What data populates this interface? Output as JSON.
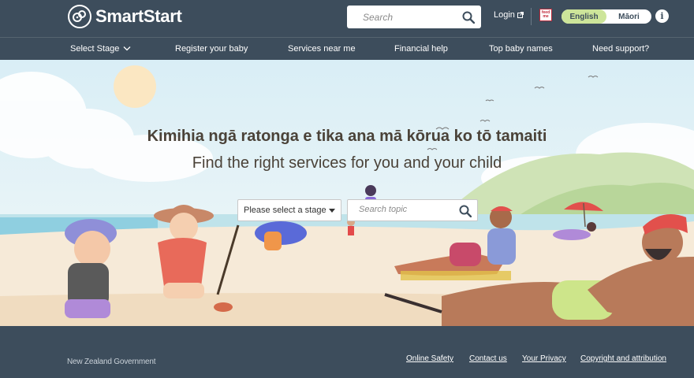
{
  "header": {
    "logo_text": "SmartStart",
    "search_placeholder": "Search",
    "login_label": "Login",
    "feedme_label": "feed me",
    "languages": [
      {
        "label": "English",
        "active": true
      },
      {
        "label": "Māori",
        "active": false
      }
    ],
    "info_label": "i"
  },
  "nav": {
    "items": [
      {
        "label": "Select Stage"
      },
      {
        "label": "Register your baby"
      },
      {
        "label": "Services near me"
      },
      {
        "label": "Financial help"
      },
      {
        "label": "Top baby names"
      },
      {
        "label": "Need support?"
      }
    ]
  },
  "hero": {
    "title_maori": "Kimihia ngā ratonga e tika ana mā kōrua ko tō tamaiti",
    "title_english": "Find the right services for you and your child",
    "stage_select_value": "Please select a stage",
    "topic_placeholder": "Search topic"
  },
  "footer": {
    "government": "New Zealand Government",
    "links": [
      {
        "label": "Online Safety"
      },
      {
        "label": "Contact us"
      },
      {
        "label": "Your Privacy"
      },
      {
        "label": "Copyright and attribution"
      }
    ]
  },
  "colors": {
    "brand_dark": "#3d4d5c",
    "language_active": "#cde59a",
    "hero_text": "#4a4238"
  }
}
